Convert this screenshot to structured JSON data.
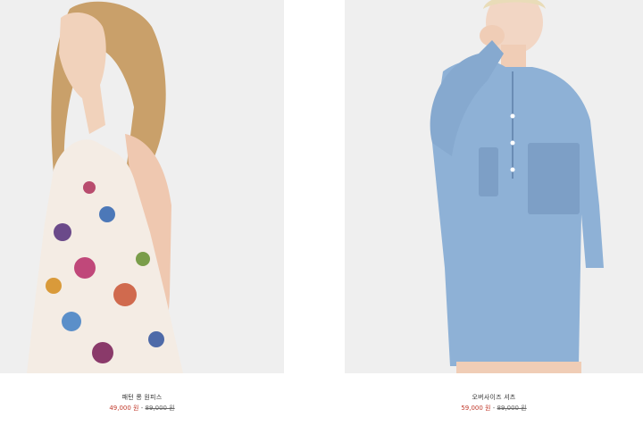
{
  "products": [
    {
      "name": "패턴 롱 원피스",
      "sale_price": "49,000 원",
      "separator": " - ",
      "original_price": "89,000 원",
      "image_icon": "photo-floral-dress"
    },
    {
      "name": "오버사이즈 셔츠",
      "sale_price": "59,000 원",
      "separator": " - ",
      "original_price": "89,000 원",
      "image_icon": "photo-denim-shirt"
    }
  ],
  "colors": {
    "sale": "#c0392b",
    "text": "#333333",
    "image_bg": "#f0f0f0"
  }
}
